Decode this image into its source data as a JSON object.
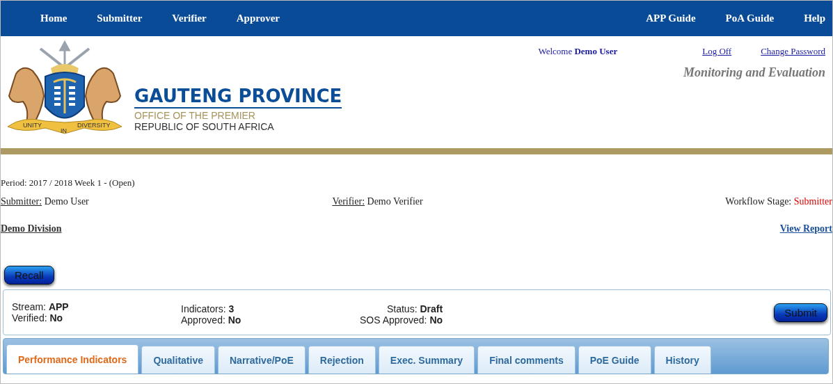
{
  "nav": {
    "left": [
      "Home",
      "Submitter",
      "Verifier",
      "Approver"
    ],
    "right": [
      "APP Guide",
      "PoA Guide",
      "Help"
    ]
  },
  "header": {
    "welcome": "Welcome",
    "user": "Demo User",
    "links": [
      "Log Off",
      "Change Password"
    ],
    "tagline": "Monitoring and Evaluation",
    "logo": {
      "title": "GAUTENG PROVINCE",
      "subtitle": "OFFICE OF THE PREMIER",
      "country": "REPUBLIC OF SOUTH AFRICA",
      "motto": [
        "UNITY",
        "IN",
        "DIVERSITY"
      ]
    }
  },
  "period": "Period: 2017 / 2018 Week 1 - (Open)",
  "people": [
    {
      "label": "Submitter:",
      "value": "Demo User"
    },
    {
      "label": "Verifier:",
      "value": "Demo Verifier"
    }
  ],
  "workflow": {
    "label": "Workflow Stage:",
    "value": "Submitter"
  },
  "division": "Demo Division",
  "view_report": "View Report",
  "recall": "Recall",
  "submit": "Submit",
  "summary": [
    [
      {
        "label": "Stream:",
        "value": "APP"
      },
      {
        "label": "Verified:",
        "value": "No"
      }
    ],
    [
      {
        "label": "Indicators:",
        "value": "3"
      },
      {
        "label": "Approved:",
        "value": "No"
      }
    ],
    [
      {
        "label": "Status:",
        "value": "Draft"
      },
      {
        "label": "SOS Approved:",
        "value": "No"
      }
    ]
  ],
  "tabs": [
    {
      "label": "Performance Indicators",
      "selected": true
    },
    {
      "label": "Qualitative",
      "selected": false
    },
    {
      "label": "Narrative/PoE",
      "selected": false
    },
    {
      "label": "Rejection",
      "selected": false
    },
    {
      "label": "Exec. Summary",
      "selected": false
    },
    {
      "label": "Final comments",
      "selected": false
    },
    {
      "label": "PoE Guide",
      "selected": false
    },
    {
      "label": "History",
      "selected": false
    }
  ]
}
